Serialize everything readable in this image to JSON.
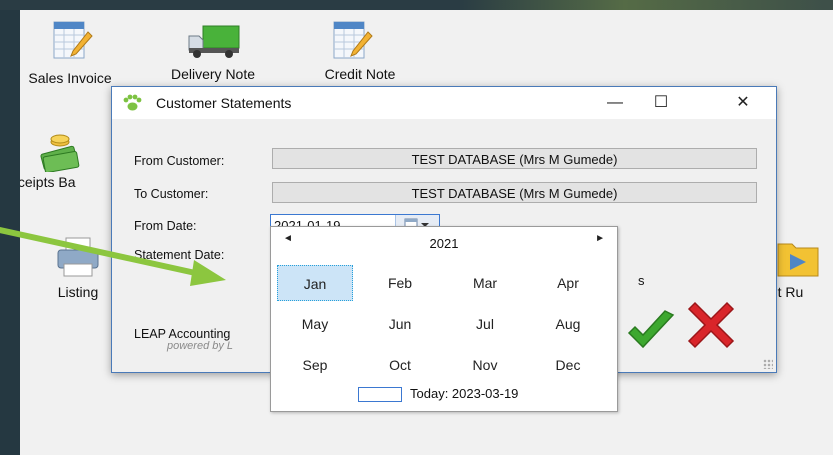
{
  "desktop": {
    "icons": [
      {
        "label": "Sales Invoice"
      },
      {
        "label": "Delivery Note"
      },
      {
        "label": "Credit Note"
      },
      {
        "label": "Receipts Ba"
      },
      {
        "label": "Listing"
      },
      {
        "label": "ent Ru"
      }
    ],
    "partial_text": "s"
  },
  "dialog": {
    "title": "Customer Statements",
    "controls": {
      "minimize": "—",
      "maximize": "☐",
      "close": "✕"
    },
    "from_customer": {
      "label": "From Customer:",
      "value": "TEST DATABASE (Mrs M Gumede)"
    },
    "to_customer": {
      "label": "To Customer:",
      "value": "TEST DATABASE (Mrs M Gumede)"
    },
    "from_date": {
      "label": "From Date:",
      "value": "2021-01-19"
    },
    "statement_date": {
      "label": "Statement Date:"
    },
    "footer": {
      "brand": "LEAP Accounting",
      "powered": "powered by L"
    }
  },
  "calendar": {
    "year": "2021",
    "prev": "◄",
    "next": "►",
    "months": [
      "Jan",
      "Feb",
      "Mar",
      "Apr",
      "May",
      "Jun",
      "Jul",
      "Aug",
      "Sep",
      "Oct",
      "Nov",
      "Dec"
    ],
    "selected_month": "Jan",
    "today": "Today: 2023-03-19"
  },
  "colors": {
    "accent": "#3b78d1",
    "arrow": "#8cc63f",
    "ok_check": "#3da82f",
    "cancel_x": "#d9252a"
  }
}
